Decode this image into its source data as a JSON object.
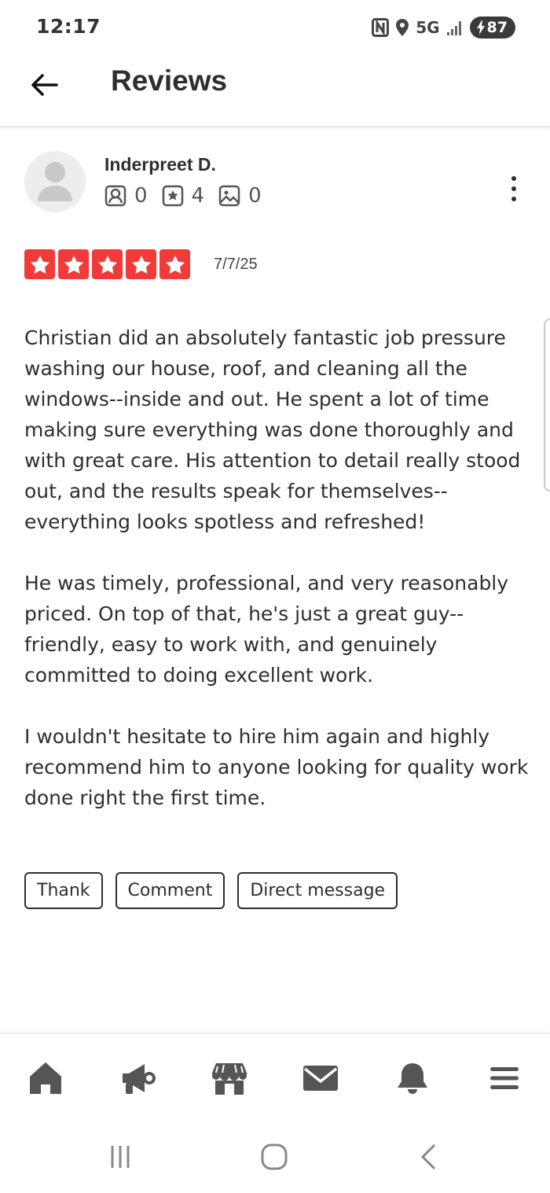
{
  "status_bar": {
    "time": "12:17",
    "network": "5G",
    "battery": "87"
  },
  "header": {
    "title": "Reviews",
    "back_icon": "arrow-left-icon"
  },
  "review": {
    "reviewer_name": "Inderpreet D.",
    "stats": {
      "friends": "0",
      "reviews": "4",
      "photos": "0"
    },
    "rating": 5,
    "date": "7/7/25",
    "paragraphs": [
      "Christian did an absolutely fantastic job pressure washing our house, roof, and cleaning all the windows--inside and out. He spent a lot of time making sure everything was done thoroughly and with great care. His attention to detail really stood out, and the results speak for themselves--everything looks spotless and refreshed!",
      "He was timely, professional, and very reasonably priced. On top of that, he's just a great guy--friendly, easy to work with, and genuinely committed to doing excellent work.",
      "I wouldn't hesitate to hire him again and highly recommend him to anyone looking for quality work done right the first time."
    ]
  },
  "actions": {
    "thank": "Thank",
    "comment": "Comment",
    "direct_message": "Direct message"
  },
  "colors": {
    "star_red": "#f43939",
    "text_dark": "#2d2e2f",
    "icon_gray": "#555555"
  },
  "bottom_nav": [
    "home-icon",
    "megaphone-icon",
    "store-icon",
    "mail-icon",
    "bell-icon",
    "menu-icon"
  ],
  "system_nav": [
    "recent-apps-icon",
    "home-circle-icon",
    "back-chevron-icon"
  ]
}
